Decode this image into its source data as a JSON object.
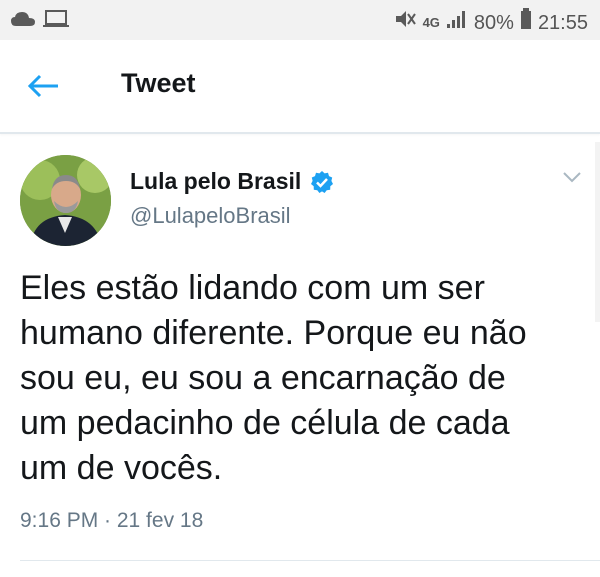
{
  "status_bar": {
    "battery": "80%",
    "time": "21:55",
    "network": "4G"
  },
  "header": {
    "title": "Tweet"
  },
  "tweet": {
    "author_name": "Lula pelo Brasil",
    "author_handle": "@LulapeloBrasil",
    "text_lines": [
      "Eles estão lidando com um ser",
      "humano diferente. Porque eu não",
      "sou eu, eu sou a encarnação de",
      "um pedacinho de célula de cada",
      "um de vocês."
    ],
    "timestamp": "9:16 PM · 21 fev 18"
  },
  "colors": {
    "accent": "#1da1f2",
    "text": "#14171a",
    "secondary": "#657786"
  },
  "icons": [
    "cloud-icon",
    "laptop-icon",
    "mute-icon",
    "signal-icon",
    "battery-icon",
    "back-arrow-icon",
    "verified-badge-icon",
    "chevron-down-icon"
  ]
}
